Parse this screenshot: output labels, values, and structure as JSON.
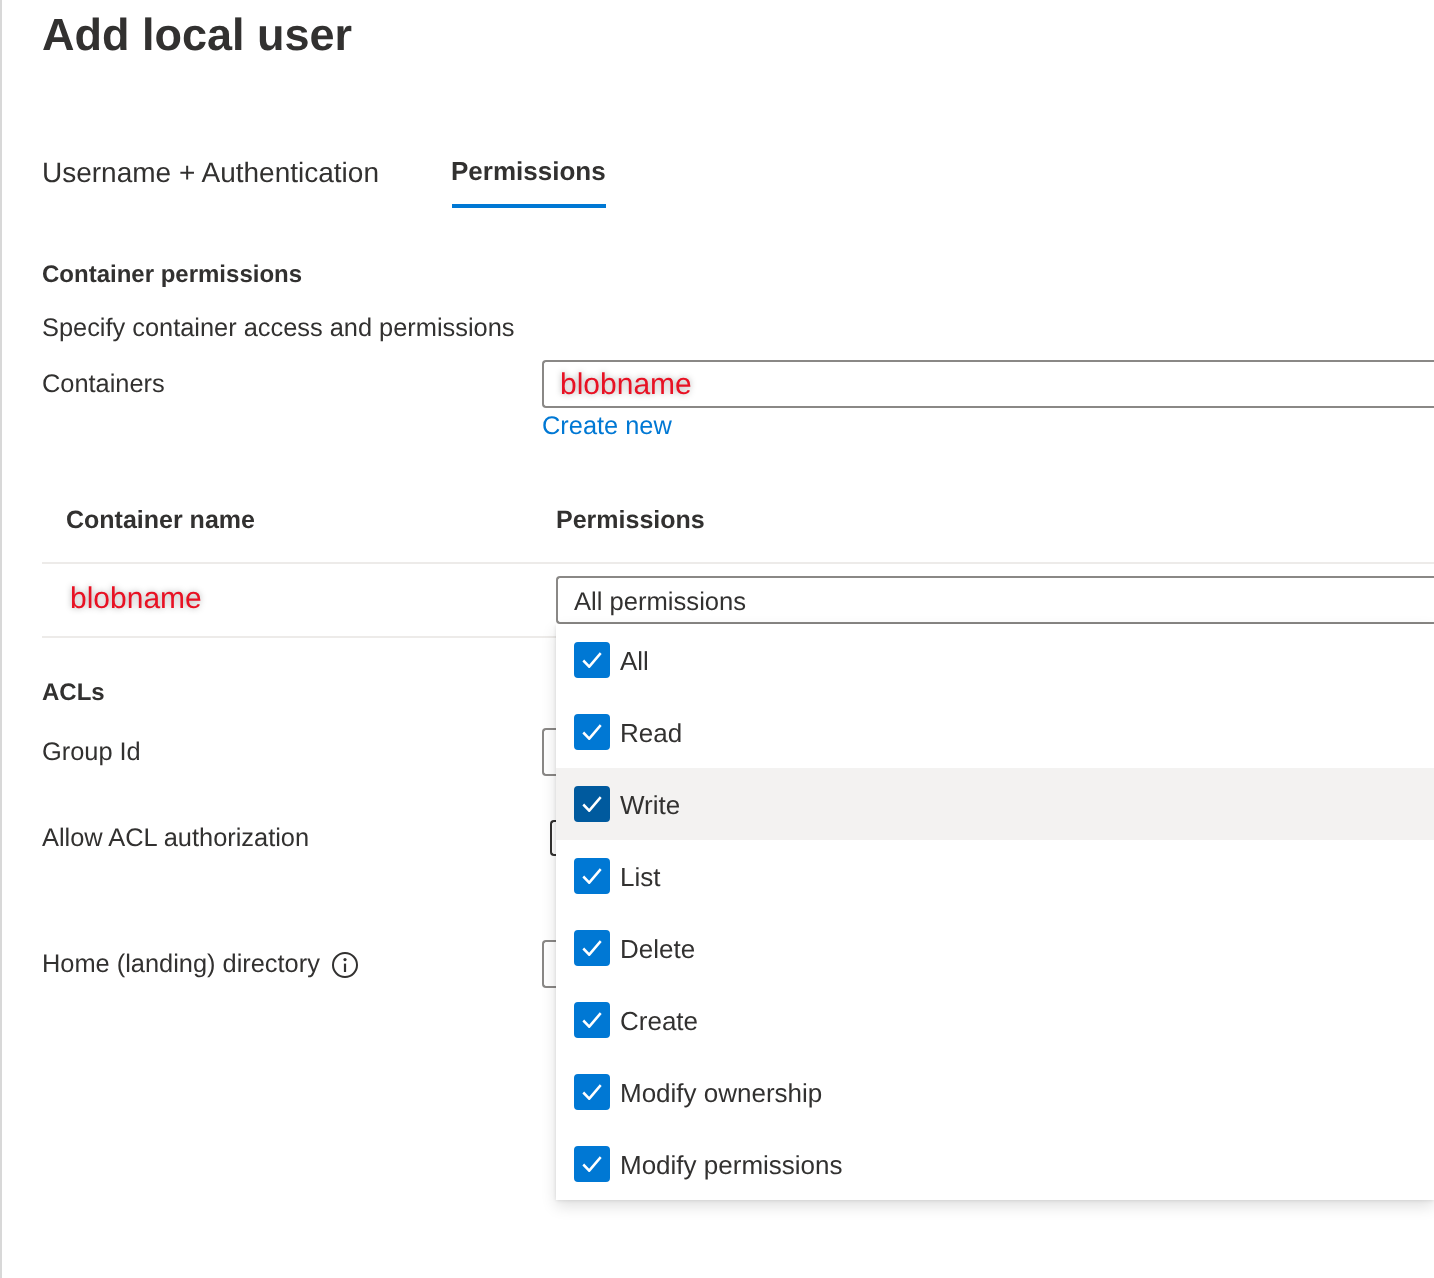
{
  "page": {
    "title": "Add local user"
  },
  "tabs": [
    {
      "label": "Username + Authentication",
      "selected": false
    },
    {
      "label": "Permissions",
      "selected": true
    }
  ],
  "container_permissions": {
    "heading": "Container permissions",
    "description": "Specify container access and permissions",
    "containers_label": "Containers",
    "containers_value": "blobname",
    "create_link": "Create new"
  },
  "table": {
    "columns": [
      "Container name",
      "Permissions"
    ],
    "rows": [
      {
        "container_name": "blobname",
        "permissions": "All permissions"
      }
    ]
  },
  "permissions_dropdown": {
    "expanded": true,
    "options": [
      {
        "label": "All",
        "checked": true,
        "highlighted": false
      },
      {
        "label": "Read",
        "checked": true,
        "highlighted": false
      },
      {
        "label": "Write",
        "checked": true,
        "highlighted": true
      },
      {
        "label": "List",
        "checked": true,
        "highlighted": false
      },
      {
        "label": "Delete",
        "checked": true,
        "highlighted": false
      },
      {
        "label": "Create",
        "checked": true,
        "highlighted": false
      },
      {
        "label": "Modify ownership",
        "checked": true,
        "highlighted": false
      },
      {
        "label": "Modify permissions",
        "checked": true,
        "highlighted": false
      }
    ]
  },
  "acls": {
    "heading": "ACLs",
    "fields": [
      {
        "label": "Group Id",
        "kind": "input",
        "info": false
      },
      {
        "label": "Allow ACL authorization",
        "kind": "checkbox",
        "checked": false,
        "info": false
      },
      {
        "label": "Home (landing) directory",
        "kind": "input",
        "info": true
      }
    ]
  }
}
